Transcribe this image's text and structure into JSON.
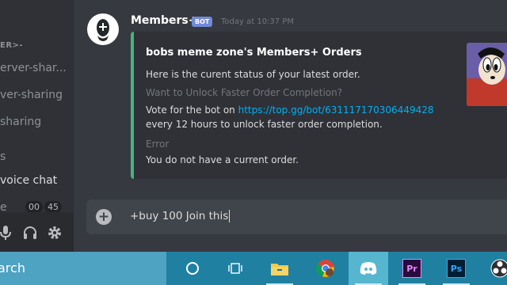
{
  "sidebar": {
    "category": "ER>-",
    "channels": [
      {
        "label": "erver-shar..."
      },
      {
        "label": "ver-sharing"
      },
      {
        "label": "sharing"
      },
      {
        "label": "s"
      },
      {
        "label": "voice chat"
      },
      {
        "label": "e"
      }
    ],
    "voice_tags": [
      "00",
      "45"
    ]
  },
  "userbar": {
    "icons": [
      "microphone-icon",
      "headphones-icon",
      "gear-icon"
    ]
  },
  "message": {
    "author": "Members+",
    "bot_badge": "BOT",
    "timestamp": "Today at 10:37 PM",
    "embed": {
      "accent_color": "#43b581",
      "title": "bobs meme zone's Members+ Orders",
      "description": "Here is the curent status of your latest order.",
      "field1_name": "Want to Unlock Faster Order Completion?",
      "field1_prefix": "Vote for the bot on ",
      "field1_link": "https://top.gg/bot/631117170306449428",
      "field1_suffix": "every 12 hours to unlock faster order completion.",
      "field2_name": "Error",
      "field2_value": "You do not have a current order."
    }
  },
  "input": {
    "value": "+buy 100 Join this",
    "plus": "+"
  },
  "taskbar": {
    "search_text": "arch",
    "icons": [
      "cortana-icon",
      "task-view-icon",
      "file-explorer-icon",
      "chrome-icon",
      "discord-icon",
      "premiere-icon",
      "photoshop-icon",
      "obs-icon"
    ],
    "premiere_label": "Pr",
    "photoshop_label": "Ps"
  }
}
